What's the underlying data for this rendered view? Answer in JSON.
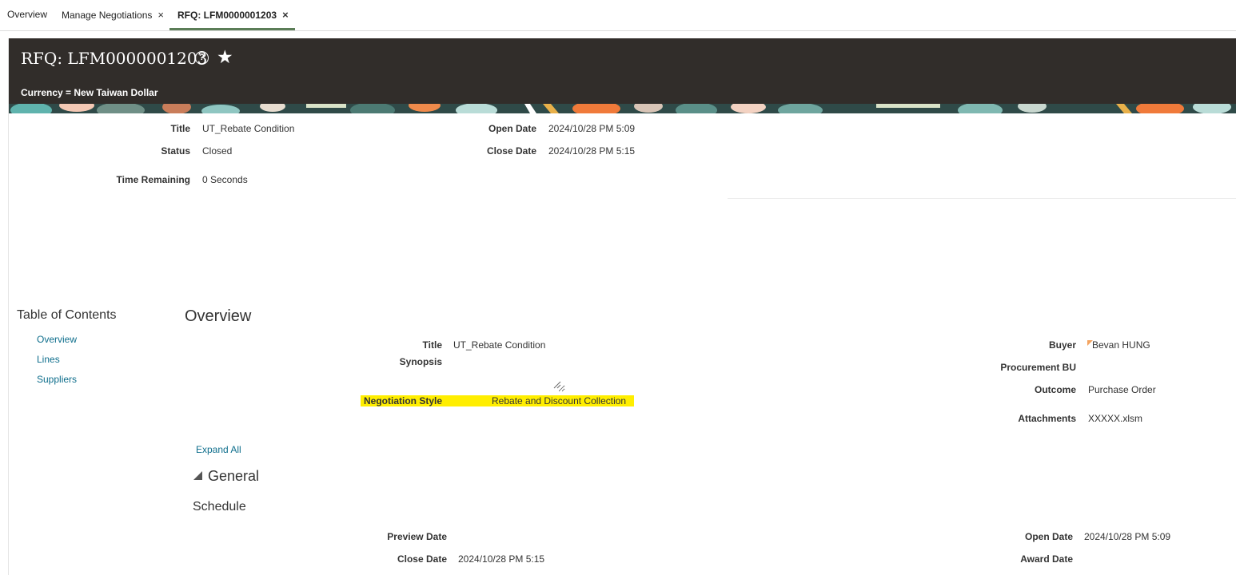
{
  "tabs": [
    {
      "label": "Overview",
      "closable": false
    },
    {
      "label": "Manage Negotiations",
      "closable": true
    },
    {
      "label": "RFQ: LFM0000001203",
      "closable": true,
      "active": true
    }
  ],
  "close_glyph": "×",
  "header": {
    "title": "RFQ: LFM0000001203",
    "help_glyph": "?",
    "star_glyph": "★",
    "currency": "Currency = New Taiwan Dollar"
  },
  "summary": {
    "title_label": "Title",
    "title_value": "UT_Rebate Condition",
    "status_label": "Status",
    "status_value": "Closed",
    "time_label": "Time Remaining",
    "time_value": "0 Seconds",
    "open_label": "Open Date",
    "open_value": "2024/10/28 PM 5:09",
    "close_label": "Close Date",
    "close_value": "2024/10/28 PM 5:15"
  },
  "toc": {
    "title": "Table of Contents",
    "items": [
      "Overview",
      "Lines",
      "Suppliers"
    ]
  },
  "overview": {
    "heading": "Overview",
    "title_label": "Title",
    "title_value": "UT_Rebate Condition",
    "synopsis_label": "Synopsis",
    "synopsis_value": "",
    "style_label": "Negotiation Style",
    "style_value": "Rebate and Discount Collection",
    "buyer_label": "Buyer",
    "buyer_value": "Bevan HUNG",
    "bu_label": "Procurement BU",
    "bu_value": "",
    "outcome_label": "Outcome",
    "outcome_value": "Purchase Order",
    "attachments_label": "Attachments",
    "attachments_value": "XXXXX.xlsm"
  },
  "expand_all": "Expand All",
  "general": "General",
  "schedule": {
    "heading": "Schedule",
    "preview_label": "Preview Date",
    "preview_value": "",
    "close_label": "Close Date",
    "close_value": "2024/10/28 PM 5:15",
    "open_label": "Open Date",
    "open_value": "2024/10/28 PM 5:09",
    "award_label": "Award Date",
    "award_value": ""
  },
  "colors": {
    "header_bg": "#312d2a",
    "active_tab_underline": "#5b7d57",
    "link": "#0e6e8c",
    "highlight": "#ffee00"
  }
}
